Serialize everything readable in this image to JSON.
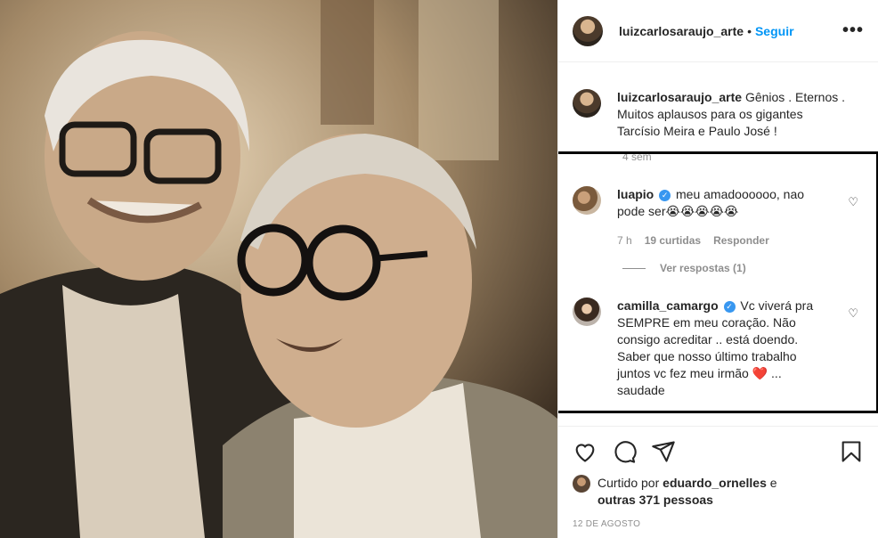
{
  "header": {
    "username": "luizcarlosaraujo_arte",
    "dot": "•",
    "follow_label": "Seguir",
    "more_label": "•••"
  },
  "caption": {
    "username": "luizcarlosaraujo_arte",
    "text_lines": [
      "Gênios . Eternos .",
      "Muitos aplausos para os gigantes",
      "Tarcísio Meira e Paulo José !"
    ],
    "time": "4 sem"
  },
  "comments": [
    {
      "username": "luapio",
      "verified": true,
      "text": "meu amadoooooo, nao pode ser😭😭😭😭😭",
      "time": "7 h",
      "likes": "19 curtidas",
      "reply_label": "Responder",
      "view_replies": "Ver respostas (1)"
    },
    {
      "username": "camilla_camargo",
      "verified": true,
      "text": "Vc viverá pra SEMPRE em meu coração. Não consigo acreditar .. está doendo. Saber que nosso último trabalho juntos vc fez meu irmão ❤️ ... saudade"
    }
  ],
  "likes": {
    "prefix": "Curtido por",
    "user": "eduardo_ornelles",
    "connector": "e",
    "others": "outras 371 pessoas"
  },
  "date": "12 DE AGOSTO",
  "icons": {
    "like": "heart-icon",
    "comment": "comment-icon",
    "share": "share-icon",
    "save": "bookmark-icon",
    "comment_like": "heart-outline-icon"
  },
  "colors": {
    "link_blue": "#0095f6",
    "verified_blue": "#3897f0",
    "muted": "#8e8e8e",
    "highlight_border": "#000000"
  }
}
